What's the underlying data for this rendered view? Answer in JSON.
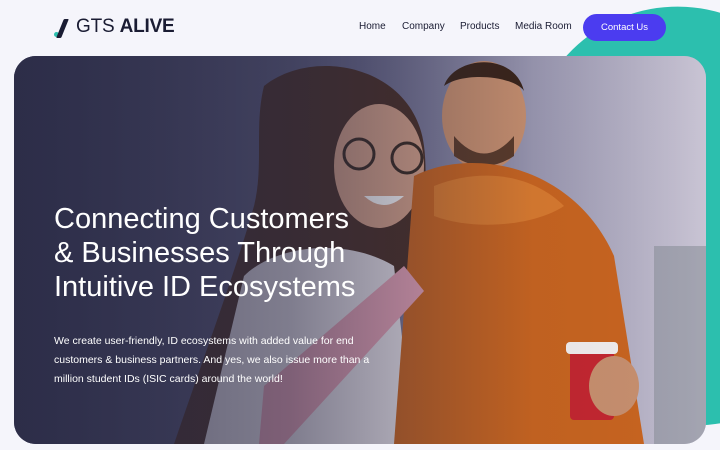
{
  "header": {
    "logo_prefix": "GTS",
    "logo_suffix": "ALIVE",
    "nav": [
      "Home",
      "Company",
      "Products",
      "Media Room"
    ],
    "cta_label": "Contact Us"
  },
  "hero": {
    "title_lines": [
      "Connecting Customers",
      "& Businesses Through",
      "Intuitive ID Ecosystems"
    ],
    "description_lines": [
      "We create user-friendly, ID ecosystems with added value for end",
      "customers & business partners. And yes, we also issue more than a",
      "million student IDs (ISIC cards) around the world!"
    ]
  },
  "colors": {
    "accent": "#4b3cf0",
    "teal": "#2cbfae",
    "text_dark": "#1a1c33",
    "background": "#f5f5fb"
  }
}
